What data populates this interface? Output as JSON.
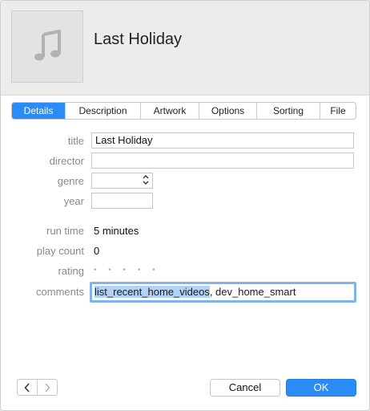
{
  "header": {
    "title": "Last Holiday",
    "artwork_icon": "music-note-icon"
  },
  "tabs": [
    {
      "label": "Details",
      "active": true
    },
    {
      "label": "Description",
      "active": false
    },
    {
      "label": "Artwork",
      "active": false
    },
    {
      "label": "Options",
      "active": false
    },
    {
      "label": "Sorting",
      "active": false
    },
    {
      "label": "File",
      "active": false
    }
  ],
  "form": {
    "title_label": "title",
    "title_value": "Last Holiday",
    "director_label": "director",
    "director_value": "",
    "genre_label": "genre",
    "genre_value": "",
    "year_label": "year",
    "year_value": "",
    "run_time_label": "run time",
    "run_time_value": "5 minutes",
    "play_count_label": "play count",
    "play_count_value": "0",
    "rating_label": "rating",
    "rating_value": 0,
    "comments_label": "comments",
    "comments_selected": "list_recent_home_videos",
    "comments_rest": ", dev_home_smart"
  },
  "footer": {
    "prev_icon": "chevron-left-icon",
    "next_icon": "chevron-right-icon",
    "cancel_label": "Cancel",
    "ok_label": "OK"
  },
  "colors": {
    "accent": "#2a8cf6",
    "selection": "#b3d3f6"
  }
}
